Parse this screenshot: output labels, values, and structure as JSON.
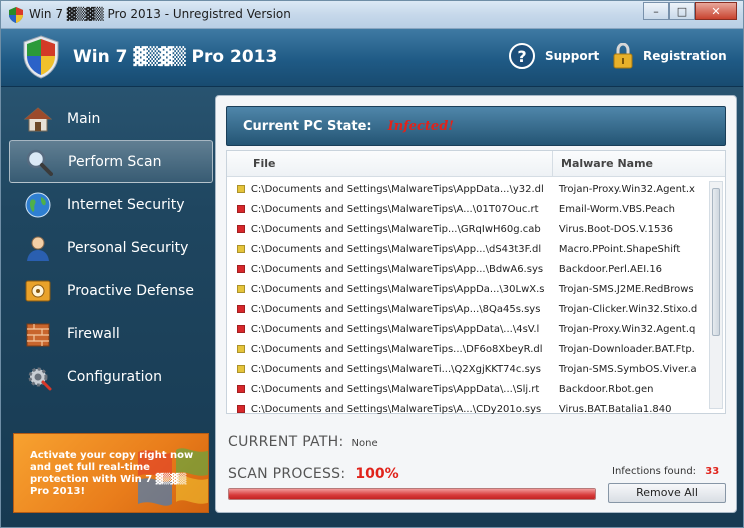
{
  "window": {
    "title": "Win 7 ▓▒▓▒ Pro 2013 - Unregistred Version",
    "controls": [
      "–",
      "□",
      "✕"
    ]
  },
  "header": {
    "app_title": "Win 7 ▓▒▓▒ Pro 2013",
    "support_label": "Support",
    "registration_label": "Registration"
  },
  "sidebar": {
    "items": [
      {
        "label": "Main",
        "icon": "home-icon"
      },
      {
        "label": "Perform Scan",
        "icon": "magnifier-icon"
      },
      {
        "label": "Internet Security",
        "icon": "globe-icon"
      },
      {
        "label": "Personal Security",
        "icon": "user-icon"
      },
      {
        "label": "Proactive Defense",
        "icon": "safe-icon"
      },
      {
        "label": "Firewall",
        "icon": "firewall-icon"
      },
      {
        "label": "Configuration",
        "icon": "gear-icon"
      }
    ],
    "active_index": 1
  },
  "promo": {
    "text": "Activate your copy right now and get full real-time protection with Win 7 ▓▒▓▒ Pro 2013!"
  },
  "state": {
    "label": "Current PC State:",
    "value": "Infected!"
  },
  "table": {
    "columns": [
      "File",
      "Malware Name"
    ],
    "rows": [
      {
        "file": "C:\\Documents and Settings\\MalwareTips\\AppData...\\y32.dl",
        "malware": "Trojan-Proxy.Win32.Agent.x",
        "severity": "medium"
      },
      {
        "file": "C:\\Documents and Settings\\MalwareTips\\A...\\01T07Ouc.rt",
        "malware": "Email-Worm.VBS.Peach",
        "severity": "high"
      },
      {
        "file": "C:\\Documents and Settings\\MalwareTip...\\GRqIwH60g.cab",
        "malware": "Virus.Boot-DOS.V.1536",
        "severity": "high"
      },
      {
        "file": "C:\\Documents and Settings\\MalwareTips\\App...\\dS43t3F.dl",
        "malware": "Macro.PPoint.ShapeShift",
        "severity": "medium"
      },
      {
        "file": "C:\\Documents and Settings\\MalwareTips\\App...\\BdwA6.sys",
        "malware": "Backdoor.Perl.AEI.16",
        "severity": "high"
      },
      {
        "file": "C:\\Documents and Settings\\MalwareTips\\AppDa...\\30LwX.s",
        "malware": "Trojan-SMS.J2ME.RedBrows",
        "severity": "medium"
      },
      {
        "file": "C:\\Documents and Settings\\MalwareTips\\Ap...\\8Qa45s.sys",
        "malware": "Trojan-Clicker.Win32.Stixo.d",
        "severity": "high"
      },
      {
        "file": "C:\\Documents and Settings\\MalwareTips\\AppData\\...\\4sV.l",
        "malware": "Trojan-Proxy.Win32.Agent.q",
        "severity": "high"
      },
      {
        "file": "C:\\Documents and Settings\\MalwareTips...\\DF6o8XbeyR.dl",
        "malware": "Trojan-Downloader.BAT.Ftp.",
        "severity": "medium"
      },
      {
        "file": "C:\\Documents and Settings\\MalwareTi...\\Q2XgjKKT74c.sys",
        "malware": "Trojan-SMS.SymbOS.Viver.a",
        "severity": "medium"
      },
      {
        "file": "C:\\Documents and Settings\\MalwareTips\\AppData\\...\\Slj.rt",
        "malware": "Backdoor.Rbot.gen",
        "severity": "high"
      },
      {
        "file": "C:\\Documents and Settings\\MalwareTips\\A...\\CDy201o.sys",
        "malware": "Virus.BAT.Batalia1.840",
        "severity": "high"
      }
    ]
  },
  "current_path": {
    "label": "CURRENT PATH:",
    "value": "None"
  },
  "scan_process": {
    "label": "SCAN PROCESS:",
    "value": "100%",
    "progress": 1.0
  },
  "infections": {
    "label": "Infections found:",
    "count": "33"
  },
  "remove_all_label": "Remove All",
  "colors": {
    "severity_high": "#d8282b",
    "severity_medium": "#e5c33a",
    "alert": "#e0231b"
  }
}
